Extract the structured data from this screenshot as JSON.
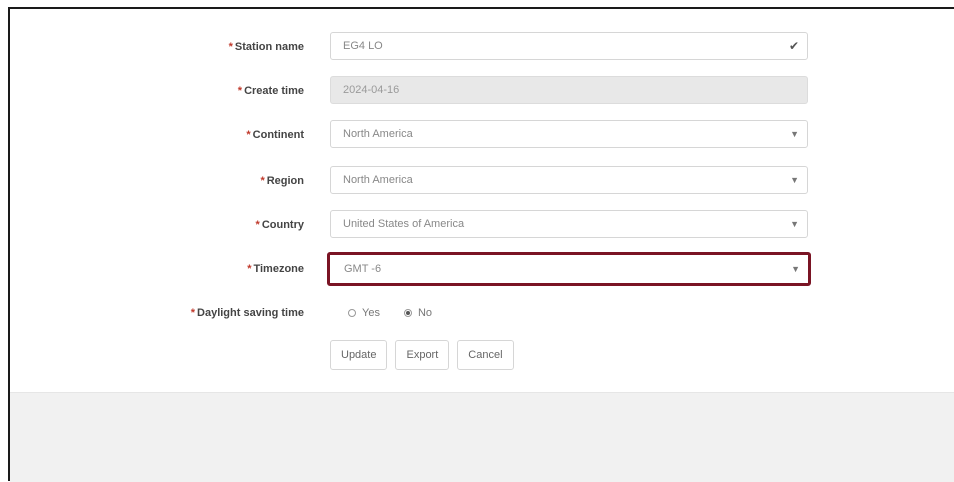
{
  "form": {
    "station_name": {
      "label": "Station name",
      "value": "EG4 LO",
      "icon": "check-icon"
    },
    "create_time": {
      "label": "Create time",
      "value": "2024-04-16"
    },
    "continent": {
      "label": "Continent",
      "value": "North America"
    },
    "region": {
      "label": "Region",
      "value": "North America"
    },
    "country": {
      "label": "Country",
      "value": "United States of America"
    },
    "timezone": {
      "label": "Timezone",
      "value": "GMT -6",
      "highlight_color": "#7a1424"
    },
    "daylight_saving": {
      "label": "Daylight saving time",
      "options": [
        "Yes",
        "No"
      ],
      "selected": "No"
    },
    "required_marker": "*"
  },
  "buttons": {
    "update": "Update",
    "export": "Export",
    "cancel": "Cancel"
  }
}
